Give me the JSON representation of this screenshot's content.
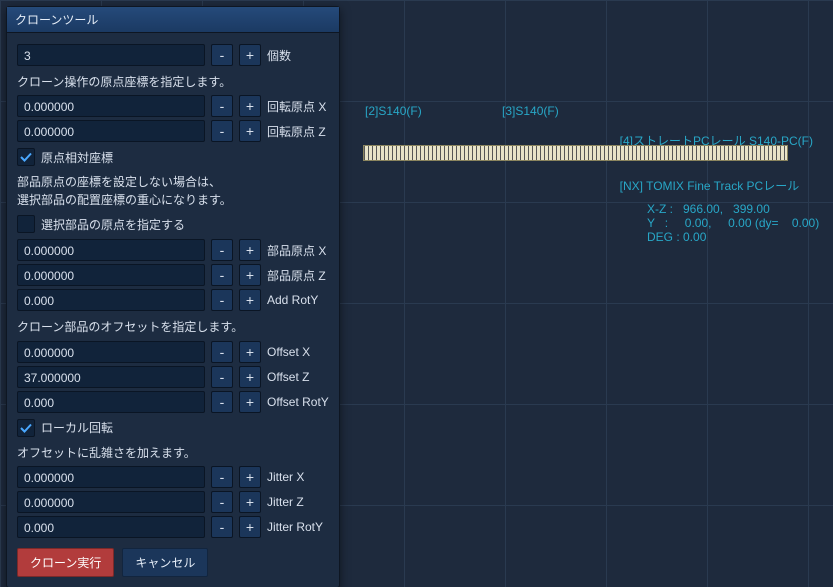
{
  "panel": {
    "title": "クローンツール",
    "count": {
      "value": "3",
      "label": "個数"
    },
    "origin_help": "クローン操作の原点座標を指定します。",
    "rot_origin_x": {
      "value": "0.000000",
      "label": "回転原点 X"
    },
    "rot_origin_z": {
      "value": "0.000000",
      "label": "回転原点 Z"
    },
    "relative_origin": {
      "checked": true,
      "label": "原点相対座標"
    },
    "partorigin_help_l1": "部品原点の座標を設定しない場合は、",
    "partorigin_help_l2": "選択部品の配置座標の重心になります。",
    "specify_part_origin": {
      "checked": false,
      "label": "選択部品の原点を指定する"
    },
    "part_origin_x": {
      "value": "0.000000",
      "label": "部品原点 X"
    },
    "part_origin_z": {
      "value": "0.000000",
      "label": "部品原点 Z"
    },
    "add_roty": {
      "value": "0.000",
      "label": "Add RotY"
    },
    "offset_help": "クローン部品のオフセットを指定します。",
    "offset_x": {
      "value": "0.000000",
      "label": "Offset X"
    },
    "offset_z": {
      "value": "37.000000",
      "label": "Offset Z"
    },
    "offset_roty": {
      "value": "0.000",
      "label": "Offset RotY"
    },
    "local_rotation": {
      "checked": true,
      "label": "ローカル回転"
    },
    "jitter_help": "オフセットに乱雑さを加えます。",
    "jitter_x": {
      "value": "0.000000",
      "label": "Jitter X"
    },
    "jitter_z": {
      "value": "0.000000",
      "label": "Jitter Z"
    },
    "jitter_roty": {
      "value": "0.000",
      "label": "Jitter RotY"
    },
    "buttons": {
      "execute": "クローン実行",
      "cancel": "キャンセル"
    }
  },
  "viewport": {
    "labels": {
      "l2": "[2]S140(F)",
      "l3": "[3]S140(F)",
      "l4a": "[4]ストレートPCレール S140-PC(F)",
      "l4b": "[NX] TOMIX Fine Track PCレール"
    },
    "readout": "X-Z :   966.00,   399.00\nY   :     0.00,     0.00 (dy=    0.00)\nDEG : 0.00"
  }
}
